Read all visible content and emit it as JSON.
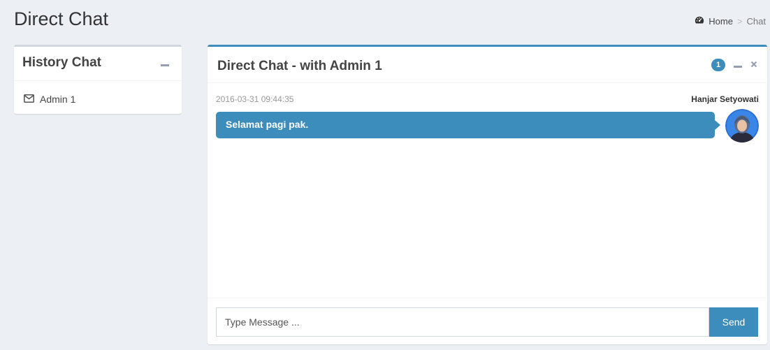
{
  "header": {
    "title": "Direct Chat",
    "breadcrumb": {
      "home_icon": "dashboard-icon",
      "home_label": "Home",
      "separator": ">",
      "current": "Chat"
    }
  },
  "history_box": {
    "title": "History Chat",
    "collapse_icon": "minus-icon",
    "items": [
      {
        "icon": "envelope-icon",
        "label": "Admin 1"
      }
    ]
  },
  "chat_box": {
    "title": "Direct Chat - with Admin 1",
    "badge": "1",
    "collapse_icon": "minus-icon",
    "close_icon": "close-icon",
    "messages": [
      {
        "timestamp": "2016-03-31 09:44:35",
        "sender": "Hanjar Setyowati",
        "text": "Selamat pagi pak.",
        "avatar": "user-avatar"
      }
    ],
    "input_placeholder": "Type Message ...",
    "send_label": "Send"
  },
  "colors": {
    "primary": "#3c8dbc",
    "background": "#ecf0f5",
    "panel": "#ffffff",
    "default_border": "#d2d6de"
  }
}
